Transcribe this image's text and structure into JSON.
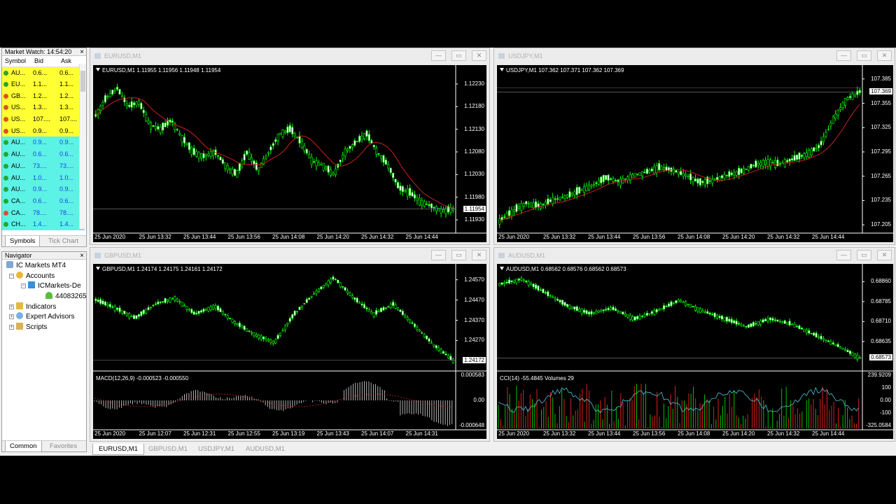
{
  "market_watch": {
    "title": "Market Watch: 14:54:20",
    "close": "×",
    "columns": [
      "Symbol",
      "Bid",
      "Ask"
    ],
    "rows": [
      {
        "symbol": "AU...",
        "bid": "0.6...",
        "ask": "0.6...",
        "color": "up",
        "dot": "g"
      },
      {
        "symbol": "EU...",
        "bid": "1.1...",
        "ask": "1.1...",
        "color": "up",
        "dot": "g"
      },
      {
        "symbol": "GB...",
        "bid": "1.2...",
        "ask": "1.2...",
        "color": "up",
        "dot": "r"
      },
      {
        "symbol": "US...",
        "bid": "1.3...",
        "ask": "1.3...",
        "color": "up",
        "dot": "r"
      },
      {
        "symbol": "US...",
        "bid": "107....",
        "ask": "107....",
        "color": "up",
        "dot": "r"
      },
      {
        "symbol": "US...",
        "bid": "0.9...",
        "ask": "0.9...",
        "color": "up",
        "dot": "r"
      },
      {
        "symbol": "AU...",
        "bid": "0.9...",
        "ask": "0.9...",
        "color": "dn",
        "dot": "g"
      },
      {
        "symbol": "AU...",
        "bid": "0.6...",
        "ask": "0.6...",
        "color": "dn",
        "dot": "g"
      },
      {
        "symbol": "AU...",
        "bid": "73....",
        "ask": "73....",
        "color": "dn",
        "dot": "g"
      },
      {
        "symbol": "AU...",
        "bid": "1.0...",
        "ask": "1.0...",
        "color": "dn",
        "dot": "g"
      },
      {
        "symbol": "AU...",
        "bid": "0.9...",
        "ask": "0.9...",
        "color": "dn",
        "dot": "g"
      },
      {
        "symbol": "CA...",
        "bid": "0.6...",
        "ask": "0.6...",
        "color": "dn",
        "dot": "g"
      },
      {
        "symbol": "CA...",
        "bid": "78....",
        "ask": "78....",
        "color": "dn",
        "dot": "r"
      },
      {
        "symbol": "CH...",
        "bid": "1.4...",
        "ask": "1.4...",
        "color": "dn",
        "dot": "g"
      }
    ],
    "tabs": [
      "Symbols",
      "Tick Chart"
    ]
  },
  "navigator": {
    "title": "Navigator",
    "close": "×",
    "root": "IC Markets MT4",
    "accounts": "Accounts",
    "server": "ICMarkets-De",
    "account_number": "44083265",
    "indicators": "Indicators",
    "experts": "Expert Advisors",
    "scripts": "Scripts",
    "tabs": [
      "Common",
      "Favorites"
    ]
  },
  "windows": {
    "eurusd": {
      "title": "EURUSD,M1",
      "label": "EURUSD,M1  1.11955 1.11956 1.11948 1.11954",
      "yticks": [
        "1.12230",
        "1.12180",
        "1.12130",
        "1.12080",
        "1.12030",
        "1.11980",
        "1.11930"
      ],
      "current": "1.11954",
      "xticks": [
        "25 Jun 2020",
        "25 Jun 13:32",
        "25 Jun 13:44",
        "25 Jun 13:56",
        "25 Jun 14:08",
        "25 Jun 14:20",
        "25 Jun 14:32",
        "25 Jun 14:44"
      ]
    },
    "usdjpy": {
      "title": "USDJPY,M1",
      "label": "USDJPY,M1  107.362 107.371 107.362 107.369",
      "yticks": [
        "107.385",
        "107.355",
        "107.325",
        "107.295",
        "107.265",
        "107.235",
        "107.205"
      ],
      "current": "107.369",
      "xticks": [
        "25 Jun 2020",
        "25 Jun 13:32",
        "25 Jun 13:44",
        "25 Jun 13:56",
        "25 Jun 14:08",
        "25 Jun 14:20",
        "25 Jun 14:32",
        "25 Jun 14:44"
      ]
    },
    "gbpusd": {
      "title": "GBPUSD,M1",
      "label": "GBPUSD,M1  1.24174 1.24175 1.24161 1.24172",
      "yticks": [
        "1.24570",
        "1.24470",
        "1.24370",
        "1.24270"
      ],
      "current": "1.24172",
      "indicator": "MACD(12,26,9) -0.000523 -0.000550",
      "ind_yticks": [
        "0.000583",
        "0.00",
        "-0.000648"
      ],
      "xticks": [
        "25 Jun 2020",
        "25 Jun 12:07",
        "25 Jun 12:31",
        "25 Jun 12:55",
        "25 Jun 13:19",
        "25 Jun 13:43",
        "25 Jun 14:07",
        "25 Jun 14:31"
      ]
    },
    "audusd": {
      "title": "AUDUSD,M1",
      "label": "AUDUSD,M1  0.68562 0.68576 0.68562 0.68573",
      "yticks": [
        "0.68860",
        "0.68785",
        "0.68710",
        "0.68635"
      ],
      "current": "0.68573",
      "indicator": "CCI(14) -55.4845  Volumes 29",
      "ind_yticks": [
        "239.9209",
        "100",
        "0.00",
        "-100",
        "-325.0584"
      ],
      "xticks": [
        "25 Jun 2020",
        "25 Jun 13:32",
        "25 Jun 13:44",
        "25 Jun 13:56",
        "25 Jun 14:08",
        "25 Jun 14:20",
        "25 Jun 14:32",
        "25 Jun 14:44"
      ]
    }
  },
  "window_buttons": {
    "min": "—",
    "max": "▭",
    "close": "✕"
  },
  "chart_tabs": [
    "EURUSD,M1",
    "GBPUSD,M1",
    "USDJPY,M1",
    "AUDUSD,M1"
  ],
  "colors": {
    "bull": "#00ff00",
    "ma": "#cc2020",
    "up_row": "#ffff33",
    "down_row": "#5cf2e6",
    "volume_red": "#e02020",
    "volume_green": "#00c000",
    "cci": "#4fc7d8"
  },
  "price_series": {
    "eurusd": [
      1.1216,
      1.122,
      1.1222,
      1.1218,
      1.1219,
      1.1214,
      1.1213,
      1.1215,
      1.1211,
      1.1208,
      1.1207,
      1.1208,
      1.1205,
      1.1203,
      1.1208,
      1.1204,
      1.1208,
      1.1212,
      1.1213,
      1.121,
      1.1206,
      1.1205,
      1.1203,
      1.1208,
      1.121,
      1.1212,
      1.1208,
      1.1205,
      1.12,
      1.1199,
      1.1197,
      1.1196,
      1.1195,
      1.11954
    ],
    "usdjpy": [
      107.21,
      107.222,
      107.232,
      107.228,
      107.236,
      107.24,
      107.247,
      107.254,
      107.263,
      107.258,
      107.266,
      107.27,
      107.276,
      107.272,
      107.266,
      107.257,
      107.26,
      107.266,
      107.27,
      107.278,
      107.283,
      107.28,
      107.286,
      107.292,
      107.302,
      107.335,
      107.36,
      107.369
    ]
  }
}
